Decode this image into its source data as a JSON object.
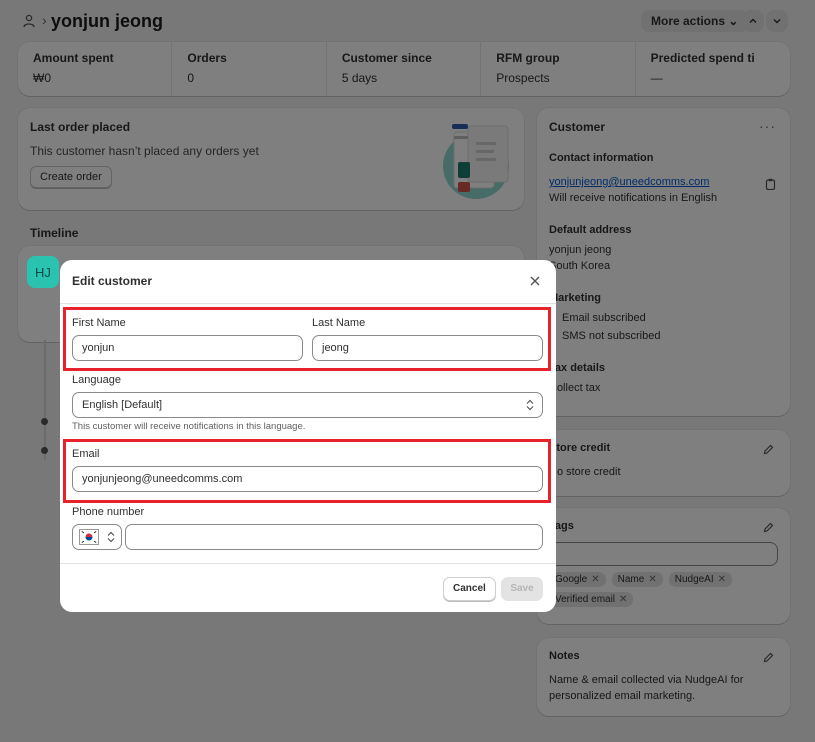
{
  "header": {
    "title": "yonjun jeong",
    "more_actions": "More actions"
  },
  "stats": [
    {
      "label": "Amount spent",
      "value": "₩0"
    },
    {
      "label": "Orders",
      "value": "0"
    },
    {
      "label": "Customer since",
      "value": "5 days"
    },
    {
      "label": "RFM group",
      "value": "Prospects"
    },
    {
      "label": "Predicted spend ti",
      "value": "—"
    }
  ],
  "last_order": {
    "title": "Last order placed",
    "description": "This customer hasn’t placed any orders yet",
    "create_order": "Create order"
  },
  "timeline": {
    "title": "Timeline",
    "avatar_initials": "HJ"
  },
  "customer": {
    "title": "Customer",
    "contact_heading": "Contact information",
    "email": "yonjunjeong@uneedcomms.com",
    "notifications": "Will receive notifications in English",
    "address_heading": "Default address",
    "address_name": "yonjun jeong",
    "address_country": "South Korea",
    "marketing_heading": "Marketing",
    "email_subscribed": "Email subscribed",
    "sms_status": "SMS not subscribed",
    "tax_heading": "Tax details",
    "tax_value": "Collect tax"
  },
  "store_credit": {
    "title": "Store credit",
    "value": "No store credit"
  },
  "tags": {
    "title": "Tags",
    "items": [
      "Google",
      "Name",
      "NudgeAI",
      "Verified email"
    ]
  },
  "notes": {
    "title": "Notes",
    "text": "Name & email collected via NudgeAI for personalized email marketing."
  },
  "modal": {
    "title": "Edit customer",
    "first_name_label": "First Name",
    "first_name_value": "yonjun",
    "last_name_label": "Last Name",
    "last_name_value": "jeong",
    "language_label": "Language",
    "language_value": "English [Default]",
    "language_help": "This customer will receive notifications in this language.",
    "email_label": "Email",
    "email_value": "yonjunjeong@uneedcomms.com",
    "phone_label": "Phone number",
    "phone_value": "",
    "cancel": "Cancel",
    "save": "Save"
  },
  "colors": {
    "highlight": "#e8222a",
    "link": "#005bd3",
    "avatar_bg": "#2ac3b0"
  }
}
